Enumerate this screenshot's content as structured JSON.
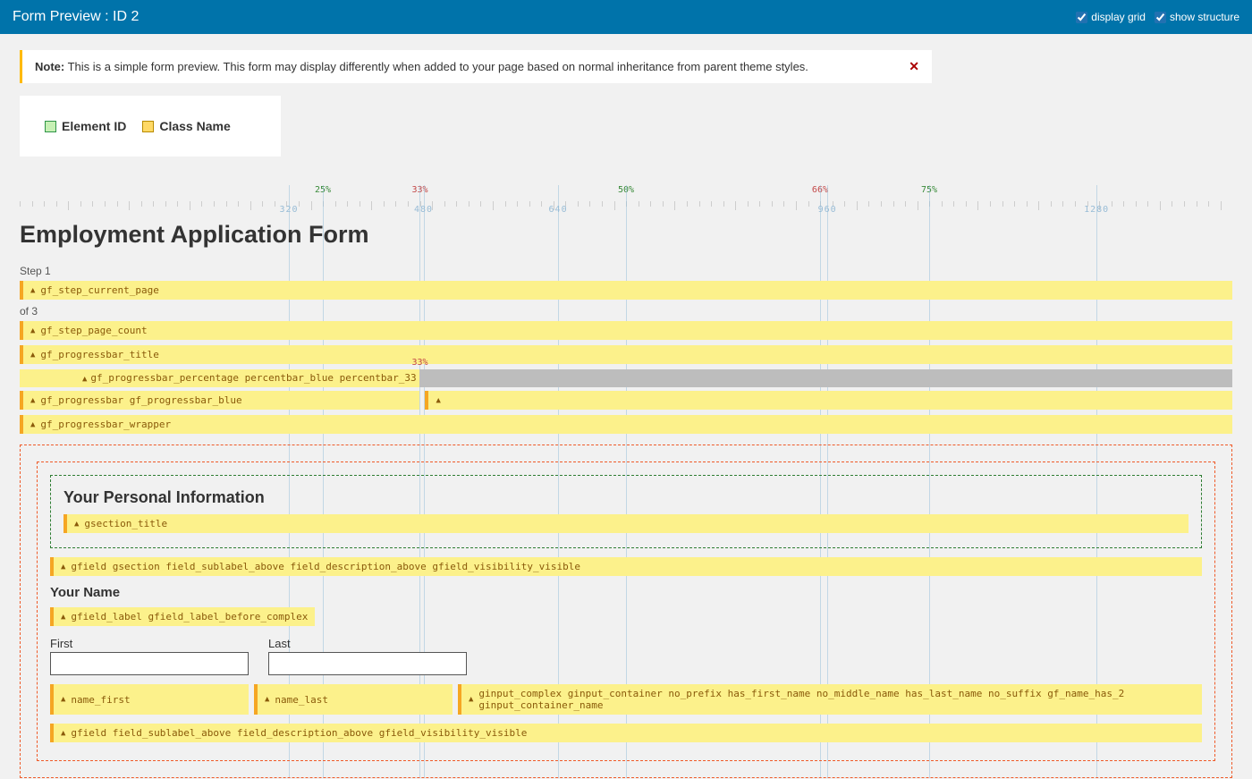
{
  "header": {
    "title": "Form Preview : ID 2",
    "option_grid": "display grid",
    "option_structure": "show structure"
  },
  "notice": {
    "prefix": "Note:",
    "text": "This is a simple form preview. This form may display differently when added to your page based on normal inheritance from parent theme styles."
  },
  "legend": {
    "element_id": "Element ID",
    "class_name": "Class Name"
  },
  "ruler": {
    "percents": [
      {
        "label": "25%",
        "pos": 25,
        "color": "green"
      },
      {
        "label": "33%",
        "pos": 33,
        "color": "red"
      },
      {
        "label": "50%",
        "pos": 50,
        "color": "green"
      },
      {
        "label": "66%",
        "pos": 66,
        "color": "red"
      },
      {
        "label": "75%",
        "pos": 75,
        "color": "green"
      }
    ],
    "pixels": [
      {
        "label": "320",
        "pos": 22.2
      },
      {
        "label": "480",
        "pos": 33.3
      },
      {
        "label": "640",
        "pos": 44.4
      },
      {
        "label": "960",
        "pos": 66.6
      },
      {
        "label": "1280",
        "pos": 88.8
      }
    ]
  },
  "form": {
    "title": "Employment Application Form",
    "step_label": "Step 1",
    "step_of": "of 3",
    "tag_step_current": "gf_step_current_page",
    "tag_step_count": "gf_step_page_count",
    "tag_progressbar_title": "gf_progressbar_title",
    "tag_progressbar_pct": "gf_progressbar_percentage percentbar_blue percentbar_33",
    "pct33_label": "33%",
    "tag_progressbar": "gf_progressbar gf_progressbar_blue",
    "tag_progressbar_wrapper": "gf_progressbar_wrapper",
    "section_title": "Your Personal Information",
    "tag_gsection_title": "gsection_title",
    "tag_gsection_field": "gfield gsection field_sublabel_above field_description_above gfield_visibility_visible",
    "name_label": "Your Name",
    "tag_name_label": "gfield_label gfield_label_before_complex",
    "first_label": "First",
    "last_label": "Last",
    "tag_name_first": "name_first",
    "tag_name_last": "name_last",
    "tag_ginput_complex": "ginput_complex ginput_container no_prefix has_first_name no_middle_name has_last_name no_suffix gf_name_has_2 ginput_container_name",
    "tag_gfield_name": "gfield field_sublabel_above field_description_above gfield_visibility_visible"
  }
}
